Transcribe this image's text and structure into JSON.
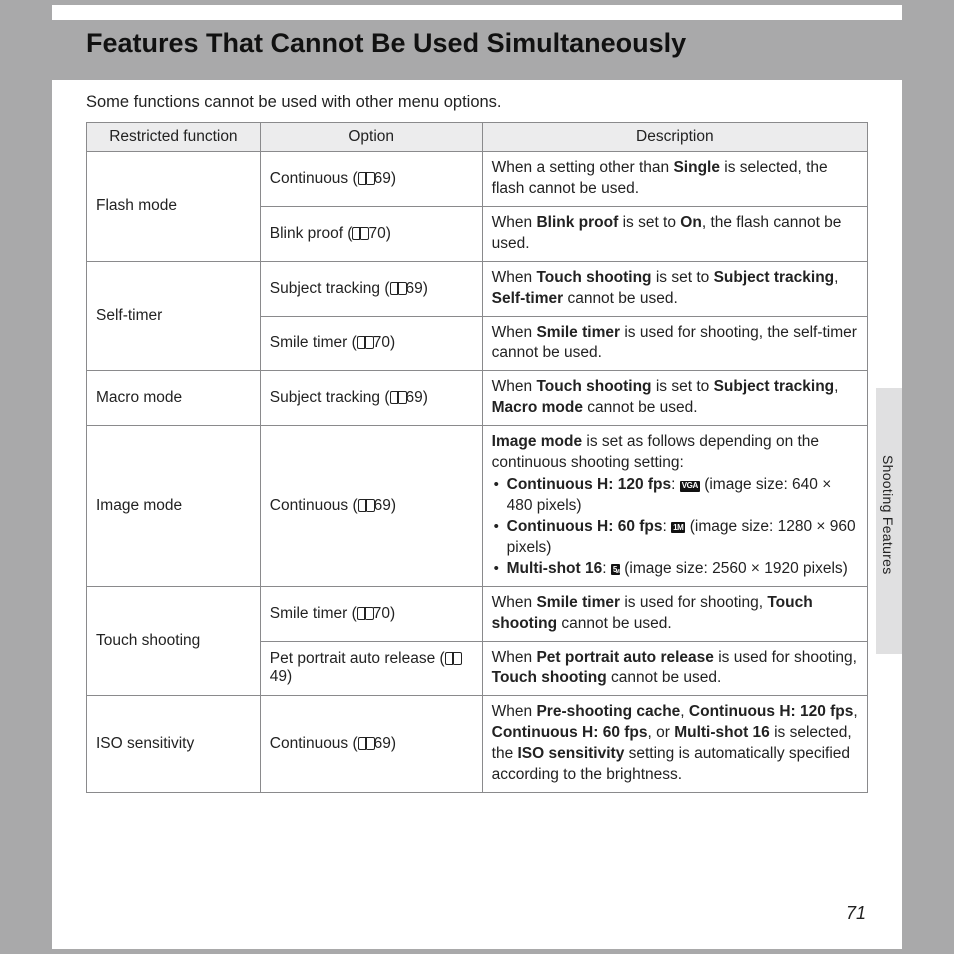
{
  "page_title": "Features That Cannot Be Used Simultaneously",
  "intro": "Some functions cannot be used with other menu options.",
  "side_label": "Shooting Features",
  "page_number": "71",
  "headers": {
    "c1": "Restricted function",
    "c2": "Option",
    "c3": "Description"
  },
  "rows": {
    "flash": {
      "label": "Flash mode",
      "o1": {
        "pre": "Continuous (",
        "pg": "69",
        "post": ")"
      },
      "d1": {
        "a": "When a setting other than ",
        "b": "Single",
        "c": " is selected, the flash cannot be used."
      },
      "o2": {
        "pre": "Blink proof (",
        "pg": "70",
        "post": ")"
      },
      "d2": {
        "a": "When ",
        "b": "Blink proof",
        "c": " is set to ",
        "d": "On",
        "e": ", the flash cannot be used."
      }
    },
    "selftimer": {
      "label": "Self-timer",
      "o1": {
        "pre": "Subject tracking (",
        "pg": "69",
        "post": ")"
      },
      "d1": {
        "a": "When ",
        "b": "Touch shooting",
        "c": " is set to ",
        "d": "Subject tracking",
        "e": ", ",
        "f": "Self-timer",
        "g": " cannot be used."
      },
      "o2": {
        "pre": "Smile timer (",
        "pg": "70",
        "post": ")"
      },
      "d2": {
        "a": "When ",
        "b": "Smile timer",
        "c": " is used for shooting, the self-timer cannot be used."
      }
    },
    "macro": {
      "label": "Macro mode",
      "o1": {
        "pre": "Subject tracking (",
        "pg": "69",
        "post": ")"
      },
      "d1": {
        "a": "When ",
        "b": "Touch shooting",
        "c": " is set to ",
        "d": "Subject tracking",
        "e": ", ",
        "f": "Macro mode",
        "g": " cannot be used."
      }
    },
    "image": {
      "label": "Image mode",
      "o1": {
        "pre": "Continuous (",
        "pg": "69",
        "post": ")"
      },
      "d1_lead_a": "Image mode",
      "d1_lead_b": " is set as follows depending on the continuous shooting setting:",
      "b1": {
        "a": "Continuous H: 120 fps",
        "b": ": ",
        "icon": "VGA",
        "c": " (image size: 640 × 480 pixels)"
      },
      "b2": {
        "a": "Continuous H: 60 fps",
        "b": ": ",
        "icon": "1M",
        "c": " (image size: 1280 × 960 pixels)"
      },
      "b3": {
        "a": "Multi-shot 16",
        "b": ": ",
        "icon": "5",
        "c": " (image size: 2560 × 1920 pixels)"
      }
    },
    "touch": {
      "label": "Touch shooting",
      "o1": {
        "pre": "Smile timer (",
        "pg": "70",
        "post": ")"
      },
      "d1": {
        "a": "When ",
        "b": "Smile timer",
        "c": " is used for shooting, ",
        "d": "Touch shooting",
        "e": " cannot be used."
      },
      "o2": {
        "pre": "Pet portrait auto release (",
        "pg": "49",
        "post": ")"
      },
      "d2": {
        "a": "When ",
        "b": "Pet portrait auto release",
        "c": " is used for shooting, ",
        "d": "Touch shooting",
        "e": " cannot be used."
      }
    },
    "iso": {
      "label": "ISO sensitivity",
      "o1": {
        "pre": "Continuous (",
        "pg": "69",
        "post": ")"
      },
      "d1": {
        "a": "When ",
        "b": "Pre-shooting cache",
        "c": ", ",
        "d": "Continuous H: 120 fps",
        "e": ", ",
        "f": "Continuous H: 60 fps",
        "g": ", or ",
        "h": "Multi-shot 16",
        "i": " is selected, the ",
        "j": "ISO sensitivity",
        "k": " setting is automatically specified according to the brightness."
      }
    }
  }
}
